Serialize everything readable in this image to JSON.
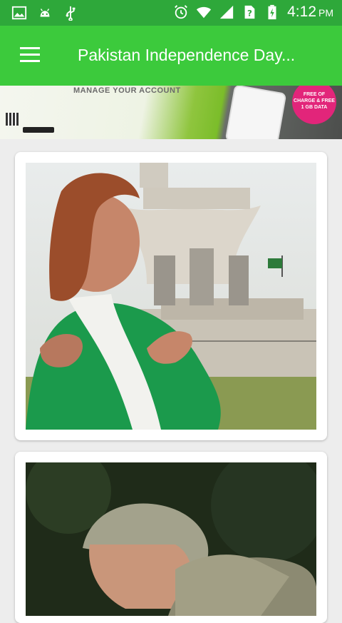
{
  "status_bar": {
    "time": "4:12",
    "ampm": "PM",
    "icons": [
      "image-icon",
      "android-icon",
      "usb-icon",
      "alarm-icon",
      "wifi-icon",
      "signal-icon",
      "sim-unknown-icon",
      "battery-charging-icon"
    ]
  },
  "app_bar": {
    "title": "Pakistan Independence Day...",
    "menu_icon": "hamburger-menu-icon"
  },
  "banner": {
    "text": "MANAGE YOUR ACCOUNT",
    "badge_text": "FREE OF CHARGE & FREE 1 GB DATA"
  },
  "colors": {
    "status_bar": "#2ea83a",
    "app_bar": "#3cca3c",
    "background": "#ededed"
  }
}
